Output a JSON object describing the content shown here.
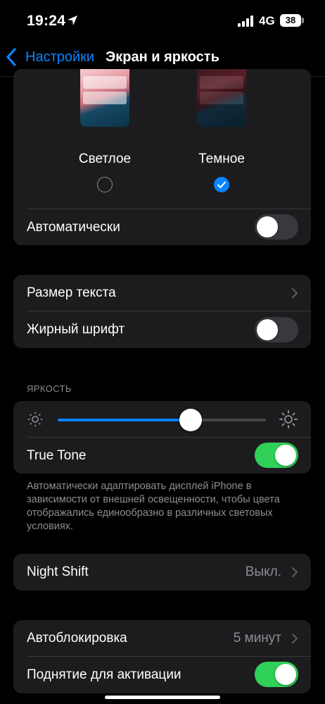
{
  "status_bar": {
    "time": "19:24",
    "network": "4G",
    "battery": "38"
  },
  "nav": {
    "back_label": "Настройки",
    "title": "Экран и яркость"
  },
  "appearance": {
    "light_label": "Светлое",
    "dark_label": "Темное",
    "selected": "dark",
    "auto_label": "Автоматически",
    "auto_on": false
  },
  "text_group": {
    "text_size_label": "Размер текста",
    "bold_label": "Жирный шрифт",
    "bold_on": false
  },
  "brightness": {
    "header": "ЯРКОСТЬ",
    "level": 0.64,
    "true_tone_label": "True Tone",
    "true_tone_on": true,
    "note": "Автоматически адаптировать дисплей iPhone в зависимости от внешней освещенности, чтобы цвета отображались единообразно в различных световых условиях."
  },
  "night_shift": {
    "label": "Night Shift",
    "value": "Выкл."
  },
  "lock_group": {
    "auto_lock_label": "Автоблокировка",
    "auto_lock_value": "5 минут",
    "raise_label": "Поднятие для активации",
    "raise_on": true
  },
  "colors": {
    "accent": "#0a84ff",
    "toggle_on": "#30d158",
    "card": "#1c1c1e"
  }
}
